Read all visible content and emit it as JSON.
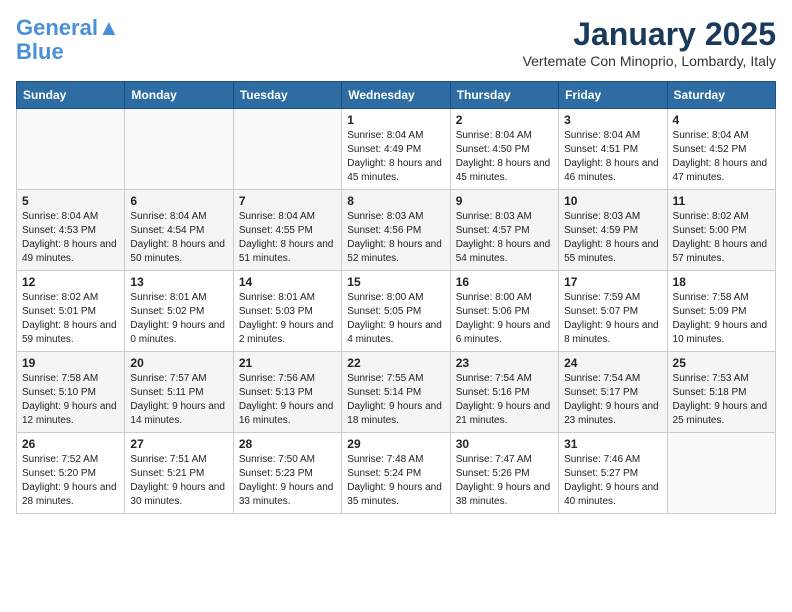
{
  "logo": {
    "line1": "General",
    "line2": "Blue",
    "tagline": ""
  },
  "title": "January 2025",
  "location": "Vertemate Con Minoprio, Lombardy, Italy",
  "weekdays": [
    "Sunday",
    "Monday",
    "Tuesday",
    "Wednesday",
    "Thursday",
    "Friday",
    "Saturday"
  ],
  "weeks": [
    [
      {
        "day": "",
        "info": ""
      },
      {
        "day": "",
        "info": ""
      },
      {
        "day": "",
        "info": ""
      },
      {
        "day": "1",
        "info": "Sunrise: 8:04 AM\nSunset: 4:49 PM\nDaylight: 8 hours\nand 45 minutes."
      },
      {
        "day": "2",
        "info": "Sunrise: 8:04 AM\nSunset: 4:50 PM\nDaylight: 8 hours\nand 45 minutes."
      },
      {
        "day": "3",
        "info": "Sunrise: 8:04 AM\nSunset: 4:51 PM\nDaylight: 8 hours\nand 46 minutes."
      },
      {
        "day": "4",
        "info": "Sunrise: 8:04 AM\nSunset: 4:52 PM\nDaylight: 8 hours\nand 47 minutes."
      }
    ],
    [
      {
        "day": "5",
        "info": "Sunrise: 8:04 AM\nSunset: 4:53 PM\nDaylight: 8 hours\nand 49 minutes."
      },
      {
        "day": "6",
        "info": "Sunrise: 8:04 AM\nSunset: 4:54 PM\nDaylight: 8 hours\nand 50 minutes."
      },
      {
        "day": "7",
        "info": "Sunrise: 8:04 AM\nSunset: 4:55 PM\nDaylight: 8 hours\nand 51 minutes."
      },
      {
        "day": "8",
        "info": "Sunrise: 8:03 AM\nSunset: 4:56 PM\nDaylight: 8 hours\nand 52 minutes."
      },
      {
        "day": "9",
        "info": "Sunrise: 8:03 AM\nSunset: 4:57 PM\nDaylight: 8 hours\nand 54 minutes."
      },
      {
        "day": "10",
        "info": "Sunrise: 8:03 AM\nSunset: 4:59 PM\nDaylight: 8 hours\nand 55 minutes."
      },
      {
        "day": "11",
        "info": "Sunrise: 8:02 AM\nSunset: 5:00 PM\nDaylight: 8 hours\nand 57 minutes."
      }
    ],
    [
      {
        "day": "12",
        "info": "Sunrise: 8:02 AM\nSunset: 5:01 PM\nDaylight: 8 hours\nand 59 minutes."
      },
      {
        "day": "13",
        "info": "Sunrise: 8:01 AM\nSunset: 5:02 PM\nDaylight: 9 hours\nand 0 minutes."
      },
      {
        "day": "14",
        "info": "Sunrise: 8:01 AM\nSunset: 5:03 PM\nDaylight: 9 hours\nand 2 minutes."
      },
      {
        "day": "15",
        "info": "Sunrise: 8:00 AM\nSunset: 5:05 PM\nDaylight: 9 hours\nand 4 minutes."
      },
      {
        "day": "16",
        "info": "Sunrise: 8:00 AM\nSunset: 5:06 PM\nDaylight: 9 hours\nand 6 minutes."
      },
      {
        "day": "17",
        "info": "Sunrise: 7:59 AM\nSunset: 5:07 PM\nDaylight: 9 hours\nand 8 minutes."
      },
      {
        "day": "18",
        "info": "Sunrise: 7:58 AM\nSunset: 5:09 PM\nDaylight: 9 hours\nand 10 minutes."
      }
    ],
    [
      {
        "day": "19",
        "info": "Sunrise: 7:58 AM\nSunset: 5:10 PM\nDaylight: 9 hours\nand 12 minutes."
      },
      {
        "day": "20",
        "info": "Sunrise: 7:57 AM\nSunset: 5:11 PM\nDaylight: 9 hours\nand 14 minutes."
      },
      {
        "day": "21",
        "info": "Sunrise: 7:56 AM\nSunset: 5:13 PM\nDaylight: 9 hours\nand 16 minutes."
      },
      {
        "day": "22",
        "info": "Sunrise: 7:55 AM\nSunset: 5:14 PM\nDaylight: 9 hours\nand 18 minutes."
      },
      {
        "day": "23",
        "info": "Sunrise: 7:54 AM\nSunset: 5:16 PM\nDaylight: 9 hours\nand 21 minutes."
      },
      {
        "day": "24",
        "info": "Sunrise: 7:54 AM\nSunset: 5:17 PM\nDaylight: 9 hours\nand 23 minutes."
      },
      {
        "day": "25",
        "info": "Sunrise: 7:53 AM\nSunset: 5:18 PM\nDaylight: 9 hours\nand 25 minutes."
      }
    ],
    [
      {
        "day": "26",
        "info": "Sunrise: 7:52 AM\nSunset: 5:20 PM\nDaylight: 9 hours\nand 28 minutes."
      },
      {
        "day": "27",
        "info": "Sunrise: 7:51 AM\nSunset: 5:21 PM\nDaylight: 9 hours\nand 30 minutes."
      },
      {
        "day": "28",
        "info": "Sunrise: 7:50 AM\nSunset: 5:23 PM\nDaylight: 9 hours\nand 33 minutes."
      },
      {
        "day": "29",
        "info": "Sunrise: 7:48 AM\nSunset: 5:24 PM\nDaylight: 9 hours\nand 35 minutes."
      },
      {
        "day": "30",
        "info": "Sunrise: 7:47 AM\nSunset: 5:26 PM\nDaylight: 9 hours\nand 38 minutes."
      },
      {
        "day": "31",
        "info": "Sunrise: 7:46 AM\nSunset: 5:27 PM\nDaylight: 9 hours\nand 40 minutes."
      },
      {
        "day": "",
        "info": ""
      }
    ]
  ]
}
